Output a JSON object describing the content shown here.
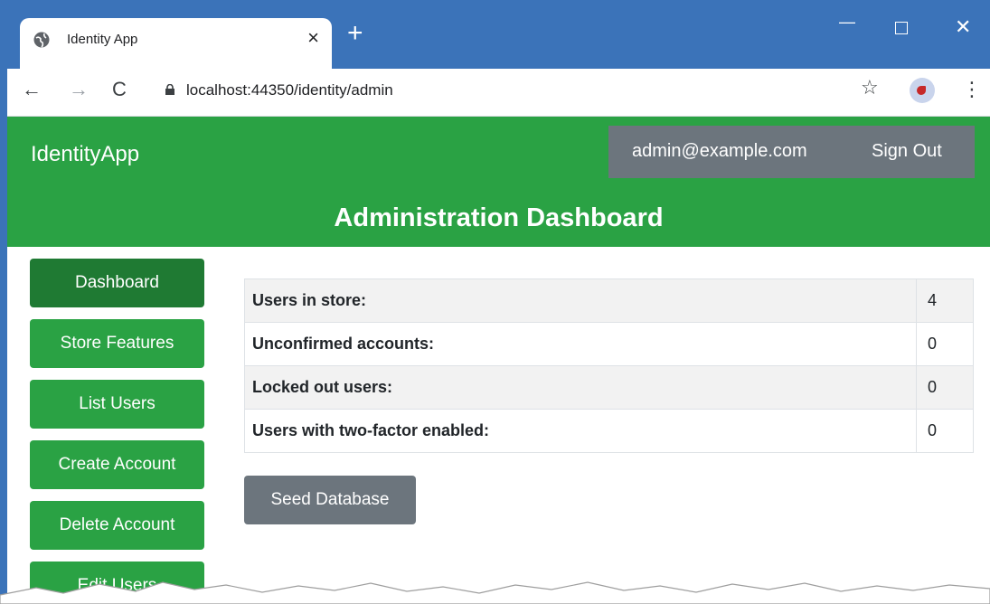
{
  "browser": {
    "tab_title": "Identity App",
    "tab_close": "×",
    "new_tab": "+",
    "url": "localhost:44350/identity/admin",
    "window_controls": {
      "minimize": "—",
      "close": "✕"
    },
    "nav": {
      "back": "←",
      "forward": "→",
      "reload": "C"
    },
    "star": "☆",
    "menu": "⋮"
  },
  "header": {
    "brand": "IdentityApp",
    "user_email": "admin@example.com",
    "sign_out": "Sign Out",
    "title": "Administration Dashboard",
    "color": "#2aa244"
  },
  "sidebar": {
    "items": [
      {
        "label": "Dashboard",
        "active": true
      },
      {
        "label": "Store Features",
        "active": false
      },
      {
        "label": "List Users",
        "active": false
      },
      {
        "label": "Create Account",
        "active": false
      },
      {
        "label": "Delete Account",
        "active": false
      },
      {
        "label": "Edit Users",
        "active": false
      }
    ]
  },
  "stats": {
    "rows": [
      {
        "label": "Users in store:",
        "value": "4"
      },
      {
        "label": "Unconfirmed accounts:",
        "value": "0"
      },
      {
        "label": "Locked out users:",
        "value": "0"
      },
      {
        "label": "Users with two-factor enabled:",
        "value": "0"
      }
    ]
  },
  "actions": {
    "seed_database": "Seed Database"
  }
}
